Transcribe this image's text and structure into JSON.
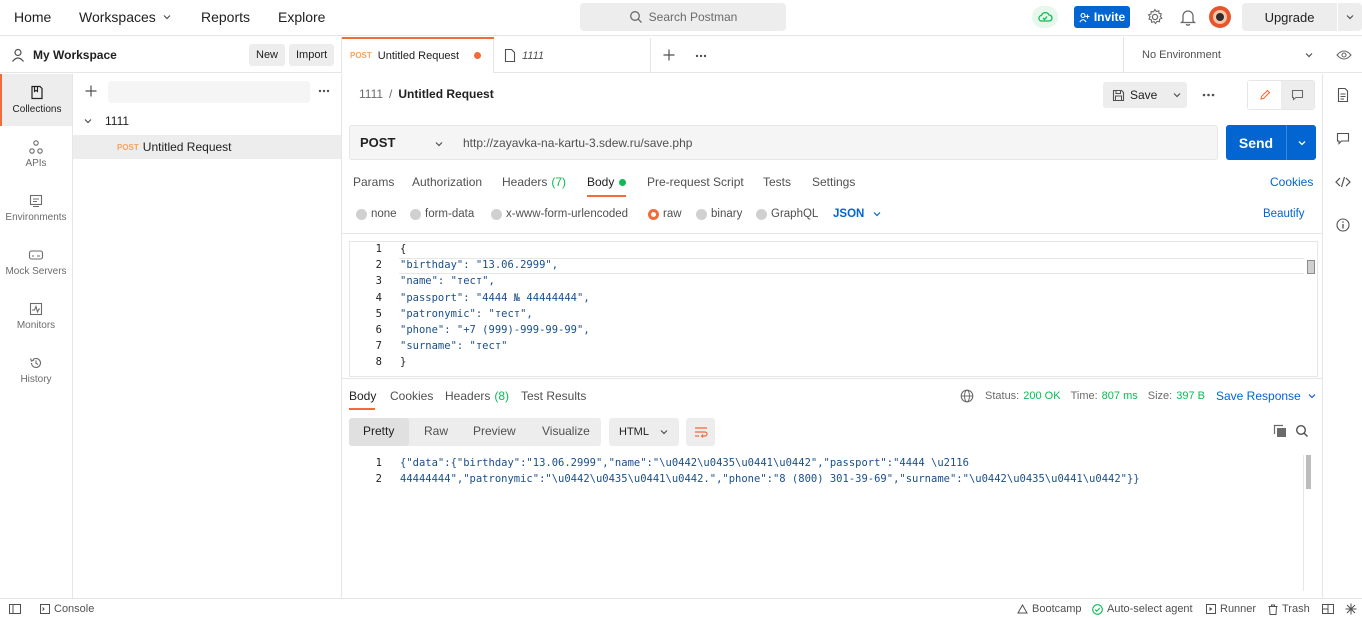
{
  "topnav": {
    "home": "Home",
    "workspaces": "Workspaces",
    "reports": "Reports",
    "explore": "Explore",
    "search_placeholder": "Search Postman",
    "invite": "Invite",
    "upgrade": "Upgrade"
  },
  "workspace": {
    "name": "My Workspace",
    "new_label": "New",
    "import_label": "Import"
  },
  "rail": {
    "items": [
      {
        "label": "Collections",
        "icon": "collections-icon",
        "active": true
      },
      {
        "label": "APIs",
        "icon": "apis-icon"
      },
      {
        "label": "Environments",
        "icon": "environments-icon"
      },
      {
        "label": "Mock Servers",
        "icon": "mock-servers-icon"
      },
      {
        "label": "Monitors",
        "icon": "monitors-icon"
      },
      {
        "label": "History",
        "icon": "history-icon"
      }
    ]
  },
  "sidebar": {
    "collection": "1111",
    "request": {
      "method": "POST",
      "name": "Untitled Request"
    }
  },
  "tabs": [
    {
      "method": "POST",
      "name": "Untitled Request",
      "unsaved": true,
      "active": true
    },
    {
      "name": "1111"
    }
  ],
  "environment": {
    "selected": "No Environment"
  },
  "request": {
    "breadcrumb_parent": "1111",
    "breadcrumb_sep": "/",
    "title": "Untitled Request",
    "save_label": "Save",
    "method": "POST",
    "url": "http://zayavka-na-kartu-3.sdew.ru/save.php",
    "send_label": "Send",
    "tabs": {
      "params": "Params",
      "authorization": "Authorization",
      "headers": "Headers",
      "headers_count": "(7)",
      "body": "Body",
      "prerequest": "Pre-request Script",
      "tests": "Tests",
      "settings": "Settings",
      "cookies": "Cookies"
    },
    "body_modes": {
      "none": "none",
      "form_data": "form-data",
      "urlencoded": "x-www-form-urlencoded",
      "raw": "raw",
      "binary": "binary",
      "graphql": "GraphQL",
      "format": "JSON",
      "beautify": "Beautify"
    },
    "body_lines": [
      {
        "n": "1",
        "text": "{"
      },
      {
        "n": "2",
        "text": "\"birthday\": \"13.06.2999\","
      },
      {
        "n": "3",
        "text": "\"name\": \"тест\","
      },
      {
        "n": "4",
        "text": "\"passport\": \"4444 № 44444444\","
      },
      {
        "n": "5",
        "text": "\"patronymic\": \"тест\","
      },
      {
        "n": "6",
        "text": "\"phone\": \"+7 (999)-999-99-99\","
      },
      {
        "n": "7",
        "text": "\"surname\": \"тест\""
      },
      {
        "n": "8",
        "text": "}"
      }
    ]
  },
  "response": {
    "tabs": {
      "body": "Body",
      "cookies": "Cookies",
      "headers": "Headers",
      "headers_count": "(8)",
      "test_results": "Test Results"
    },
    "status_label": "Status:",
    "status": "200 OK",
    "time_label": "Time:",
    "time": "807 ms",
    "size_label": "Size:",
    "size": "397 B",
    "save_response": "Save Response",
    "views": {
      "pretty": "Pretty",
      "raw": "Raw",
      "preview": "Preview",
      "visualize": "Visualize"
    },
    "language": "HTML",
    "body_lines": [
      {
        "n": "1",
        "text": "{\"data\":{\"birthday\":\"13.06.2999\",\"name\":\"\\u0442\\u0435\\u0441\\u0442\",\"passport\":\"4444 \\u2116"
      },
      {
        "n": "2",
        "text": "44444444\",\"patronymic\":\"\\u0442\\u0435\\u0441\\u0442.\",\"phone\":\"8 (800) 301-39-69\",\"surname\":\"\\u0442\\u0435\\u0441\\u0442\"}}"
      }
    ]
  },
  "bottombar": {
    "console": "Console",
    "bootcamp": "Bootcamp",
    "agent": "Auto-select agent",
    "runner": "Runner",
    "trash": "Trash"
  },
  "colors": {
    "accent_orange": "#f26b3a",
    "primary_blue": "#0265d2",
    "status_green": "#0cbb52",
    "post_method": "#f4a460"
  }
}
